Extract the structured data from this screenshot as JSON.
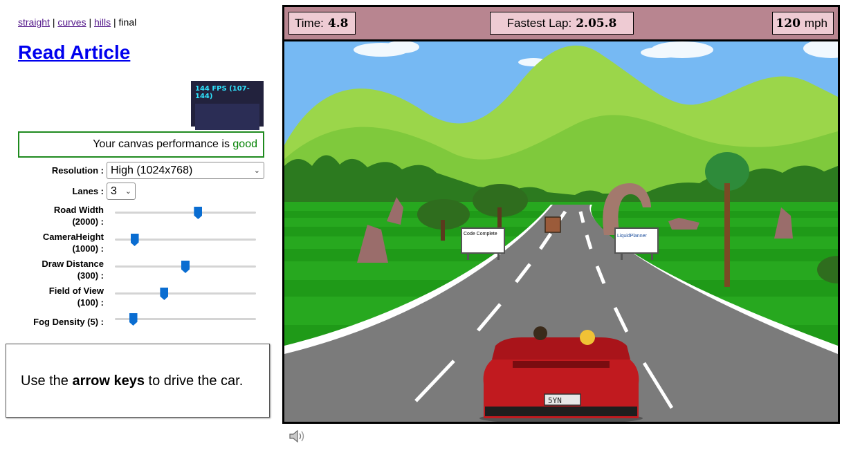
{
  "nav": {
    "links": [
      "straight",
      "curves",
      "hills"
    ],
    "separator": "|",
    "current": "final"
  },
  "read_article": "Read Article",
  "fps": {
    "text": "144 FPS (107-144)"
  },
  "performance": {
    "prefix": "Your canvas performance is ",
    "status": "good"
  },
  "settings": {
    "resolution_label": "Resolution :",
    "resolution_value": "High (1024x768)",
    "lanes_label": "Lanes :",
    "lanes_value": "3",
    "sliders": [
      {
        "label_line1": "Road Width",
        "label_line2": "(2000) :",
        "value": 0.59
      },
      {
        "label_line1": "CameraHeight",
        "label_line2": "(1000) :",
        "value": 0.14
      },
      {
        "label_line1": "Draw Distance",
        "label_line2": "(300) :",
        "value": 0.5
      },
      {
        "label_line1": "Field of View",
        "label_line2": "(100) :",
        "value": 0.35
      },
      {
        "label_line1": "Fog Density (5) :",
        "label_line2": "",
        "value": 0.13
      }
    ]
  },
  "help": {
    "prefix": "Use the ",
    "keys": "arrow keys",
    "suffix": " to drive the car."
  },
  "hud": {
    "time_label": "Time:",
    "time_value": "4.8",
    "lap_label": "Fastest Lap:",
    "lap_value": "2.05.8",
    "speed_value": "120",
    "speed_unit": "mph"
  },
  "billboards": {
    "left": "Code Complete",
    "right": "LiquidPlanner"
  },
  "car": {
    "plate": "5YN"
  },
  "icons": {
    "sound": "speaker-icon",
    "select_chevron": "chevron-down-icon"
  },
  "colors": {
    "hud_bg": "#b88590",
    "hud_box": "#eecbd3",
    "grass": "#27a81f",
    "road": "#7b7b7b",
    "car": "#c11a1f",
    "good": "#008000"
  }
}
